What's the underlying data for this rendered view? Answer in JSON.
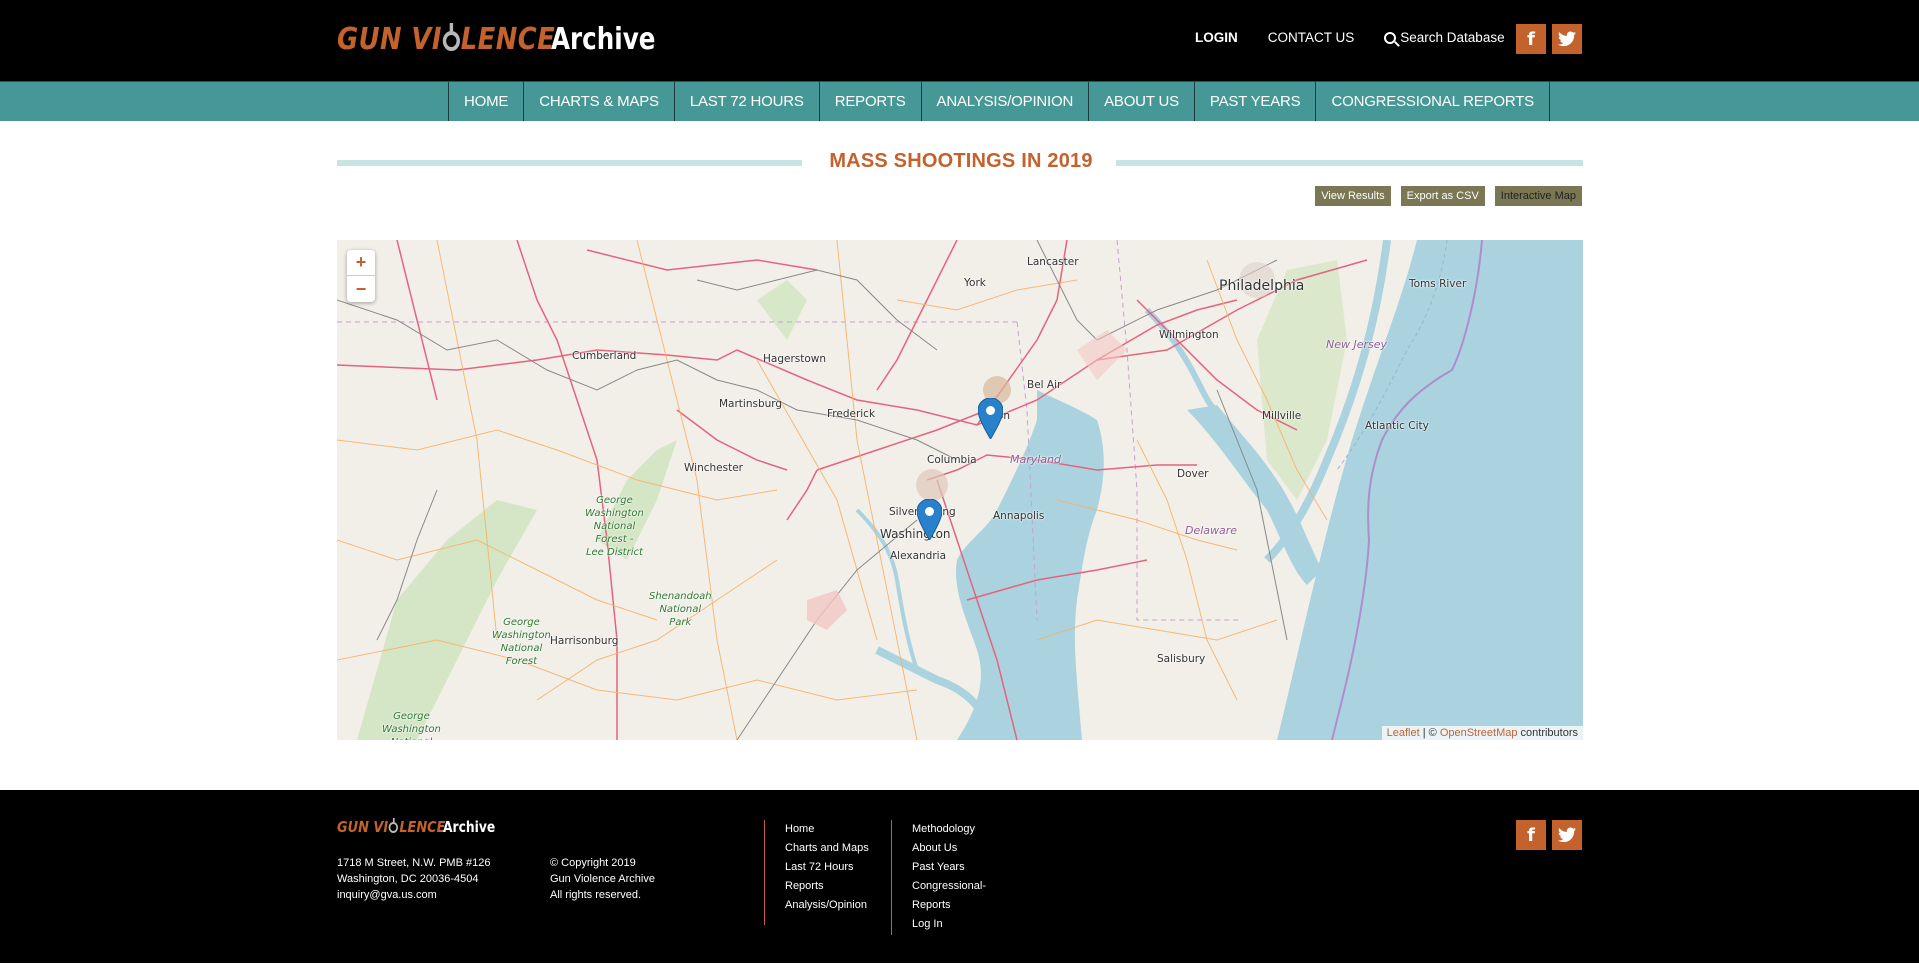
{
  "header": {
    "logo": {
      "word1": "GUN VI",
      "word2": "LENCE",
      "word3": "Archive"
    },
    "login": "LOGIN",
    "contact": "CONTACT US",
    "search": "Search Database",
    "social": {
      "facebook": "f",
      "twitter": "t"
    }
  },
  "nav": {
    "items": [
      {
        "label": "HOME"
      },
      {
        "label": "CHARTS & MAPS"
      },
      {
        "label": "LAST 72 HOURS"
      },
      {
        "label": "REPORTS"
      },
      {
        "label": "ANALYSIS/OPINION"
      },
      {
        "label": "ABOUT US"
      },
      {
        "label": "PAST YEARS"
      },
      {
        "label": "CONGRESSIONAL REPORTS"
      }
    ]
  },
  "page": {
    "title": "MASS SHOOTINGS IN 2019",
    "buttons": {
      "view_results": "View Results",
      "export_csv": "Export as CSV",
      "interactive_map": "Interactive Map"
    }
  },
  "map": {
    "zoom_in": "+",
    "zoom_out": "−",
    "attribution": {
      "leaflet": "Leaflet",
      "sep": " | © ",
      "osm": "OpenStreetMap",
      "suffix": " contributors"
    },
    "labels": {
      "lancaster": "Lancaster",
      "york": "York",
      "philadelphia": "Philadelphia",
      "toms_river": "Toms River",
      "cumberland": "Cumberland",
      "hagerstown": "Hagerstown",
      "wilmington": "Wilmington",
      "new_jersey": "New Jersey",
      "bel_air": "Bel Air",
      "martinsburg": "Martinsburg",
      "frederick": "Frederick",
      "baltimore": "on",
      "millville": "Millville",
      "atlantic_city": "Atlantic City",
      "columbia": "Columbia",
      "maryland": "Maryland",
      "winchester": "Winchester",
      "dover": "Dover",
      "silver_spring": "Silver Spring",
      "annapolis": "Annapolis",
      "washington": "Washington",
      "alexandria": "Alexandria",
      "delaware": "Delaware",
      "gw_forest_lee": "George\nWashington\nNational\nForest -\nLee District",
      "shenandoah": "Shenandoah\nNational\nPark",
      "harrisonburg": "Harrisonburg",
      "gw_forest": "George\nWashington\nNational\nForest",
      "gw_forest_2": "George\nWashington\nNational",
      "salisbury": "Salisbury"
    },
    "markers": [
      {
        "name": "Baltimore"
      },
      {
        "name": "Washington"
      }
    ]
  },
  "footer": {
    "address": [
      "1718 M Street, N.W. PMB #126",
      "Washington, DC 20036-4504",
      "inquiry@gva.us.com"
    ],
    "copyright": [
      "© Copyright 2019",
      "Gun Violence Archive",
      "All rights reserved."
    ],
    "links_col1": [
      "Home",
      "Charts and Maps",
      "Last 72 Hours",
      "Reports",
      "Analysis/Opinion"
    ],
    "links_col2": [
      "Methodology",
      "About Us",
      "Past Years",
      "Congressional-",
      "Reports",
      "Log In"
    ]
  },
  "colors": {
    "brand_orange": "#c4622d",
    "nav_teal": "#459896",
    "button_olive": "#7b7654",
    "title_rule": "#c7e3e2",
    "marker_blue": "#2a81cb"
  }
}
